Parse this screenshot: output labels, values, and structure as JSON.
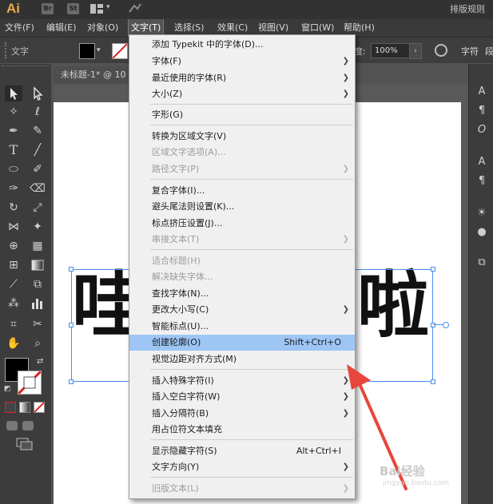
{
  "app": {
    "logo": "Ai",
    "bridge_btn": "Br",
    "stock_btn": "St",
    "workspace": "排版规则"
  },
  "menubar": [
    "文件(F)",
    "编辑(E)",
    "对象(O)",
    "文字(T)",
    "选择(S)",
    "效果(C)",
    "视图(V)",
    "窗口(W)",
    "帮助(H)"
  ],
  "controlbar": {
    "selection_label": "文字",
    "opacity_label": "度:",
    "opacity_value": "100%",
    "char_label": "字符",
    "para_label": "段"
  },
  "document": {
    "tab_title": "未标题-1* @ 10",
    "text_left": "哇",
    "text_right": "啦"
  },
  "menu": {
    "items": [
      {
        "label": "添加 Typekit 中的字体(D)...",
        "shortcut": "",
        "submenu": false,
        "disabled": false,
        "highlighted": false
      },
      {
        "label": "字体(F)",
        "shortcut": "",
        "submenu": true,
        "disabled": false,
        "highlighted": false
      },
      {
        "label": "最近使用的字体(R)",
        "shortcut": "",
        "submenu": true,
        "disabled": false,
        "highlighted": false
      },
      {
        "label": "大小(Z)",
        "shortcut": "",
        "submenu": true,
        "disabled": false,
        "highlighted": false
      },
      {
        "label": "字形(G)",
        "shortcut": "",
        "submenu": false,
        "disabled": false,
        "highlighted": false
      },
      {
        "label": "转换为区域文字(V)",
        "shortcut": "",
        "submenu": false,
        "disabled": false,
        "highlighted": false
      },
      {
        "label": "区域文字选项(A)...",
        "shortcut": "",
        "submenu": false,
        "disabled": true,
        "highlighted": false
      },
      {
        "label": "路径文字(P)",
        "shortcut": "",
        "submenu": true,
        "disabled": true,
        "highlighted": false
      },
      {
        "label": "复合字体(I)...",
        "shortcut": "",
        "submenu": false,
        "disabled": false,
        "highlighted": false
      },
      {
        "label": "避头尾法则设置(K)...",
        "shortcut": "",
        "submenu": false,
        "disabled": false,
        "highlighted": false
      },
      {
        "label": "标点挤压设置(J)...",
        "shortcut": "",
        "submenu": false,
        "disabled": false,
        "highlighted": false
      },
      {
        "label": "串接文本(T)",
        "shortcut": "",
        "submenu": true,
        "disabled": true,
        "highlighted": false
      },
      {
        "label": "适合标题(H)",
        "shortcut": "",
        "submenu": false,
        "disabled": true,
        "highlighted": false
      },
      {
        "label": "解决缺失字体...",
        "shortcut": "",
        "submenu": false,
        "disabled": true,
        "highlighted": false
      },
      {
        "label": "查找字体(N)...",
        "shortcut": "",
        "submenu": false,
        "disabled": false,
        "highlighted": false
      },
      {
        "label": "更改大小写(C)",
        "shortcut": "",
        "submenu": true,
        "disabled": false,
        "highlighted": false
      },
      {
        "label": "智能标点(U)...",
        "shortcut": "",
        "submenu": false,
        "disabled": false,
        "highlighted": false
      },
      {
        "label": "创建轮廓(O)",
        "shortcut": "Shift+Ctrl+O",
        "submenu": false,
        "disabled": false,
        "highlighted": true
      },
      {
        "label": "视觉边距对齐方式(M)",
        "shortcut": "",
        "submenu": false,
        "disabled": false,
        "highlighted": false
      },
      {
        "label": "插入特殊字符(I)",
        "shortcut": "",
        "submenu": true,
        "disabled": false,
        "highlighted": false
      },
      {
        "label": "插入空白字符(W)",
        "shortcut": "",
        "submenu": true,
        "disabled": false,
        "highlighted": false
      },
      {
        "label": "插入分隔符(B)",
        "shortcut": "",
        "submenu": true,
        "disabled": false,
        "highlighted": false
      },
      {
        "label": "用占位符文本填充",
        "shortcut": "",
        "submenu": false,
        "disabled": false,
        "highlighted": false
      },
      {
        "label": "显示隐藏字符(S)",
        "shortcut": "Alt+Ctrl+I",
        "submenu": false,
        "disabled": false,
        "highlighted": false
      },
      {
        "label": "文字方向(Y)",
        "shortcut": "",
        "submenu": true,
        "disabled": false,
        "highlighted": false
      },
      {
        "label": "旧版文本(L)",
        "shortcut": "",
        "submenu": true,
        "disabled": true,
        "highlighted": false
      }
    ]
  },
  "watermark": {
    "text": "Bai经验",
    "url": "jingyan.baidu.com"
  },
  "colors": {
    "menu_highlight": "#9dc6f5",
    "annotation_arrow": "#e8453c",
    "selection": "#4a8bf3"
  }
}
